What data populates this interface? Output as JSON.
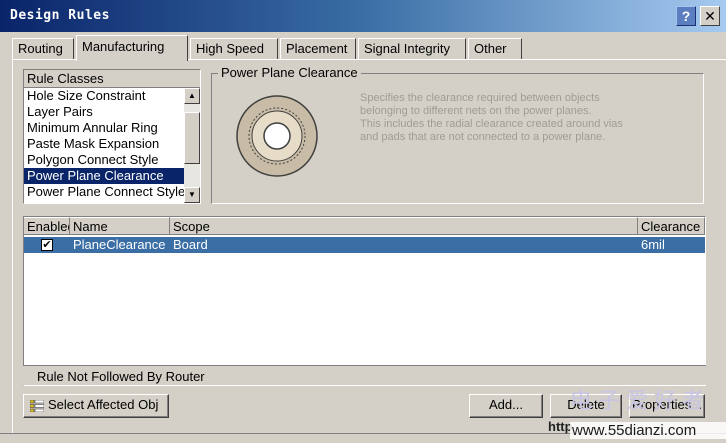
{
  "window": {
    "title": "Design Rules",
    "help_label": "?",
    "close_label": "✕"
  },
  "tabs": [
    {
      "label": "Routing",
      "active": false
    },
    {
      "label": "Manufacturing",
      "active": true
    },
    {
      "label": "High Speed",
      "active": false
    },
    {
      "label": "Placement",
      "active": false
    },
    {
      "label": "Signal Integrity",
      "active": false
    },
    {
      "label": "Other",
      "active": false
    }
  ],
  "rule_classes": {
    "header": "Rule Classes",
    "items": [
      "Hole Size Constraint",
      "Layer Pairs",
      "Minimum Annular Ring",
      "Paste Mask Expansion",
      "Polygon Connect Style",
      "Power Plane Clearance",
      "Power Plane Connect Style"
    ],
    "selected": "Power Plane Clearance",
    "scroll_up_icon": "triangle-up",
    "scroll_down_icon": "triangle-down"
  },
  "description": {
    "title": "Power Plane Clearance",
    "text": [
      "Specifies the clearance required between objects",
      "belonging to different nets on the power planes.",
      "This includes the radial clearance created around vias",
      "and pads that are not connected to a power plane."
    ],
    "icon": "plane-clearance-icon"
  },
  "grid": {
    "columns": [
      "Enabled",
      "Name",
      "Scope",
      "Clearance"
    ],
    "rows": [
      {
        "enabled": true,
        "name": "PlaneClearance",
        "scope": "Board",
        "clearance": "6mil"
      }
    ]
  },
  "status": "Rule Not Followed By Router",
  "buttons": {
    "affected": "Select Affected Obj",
    "add": "Add...",
    "delete": "Delete",
    "properties": "Properties..."
  },
  "watermark": {
    "url": "www.55dianzi.com",
    "prefix": "http",
    "cn": "电子爱好者"
  }
}
